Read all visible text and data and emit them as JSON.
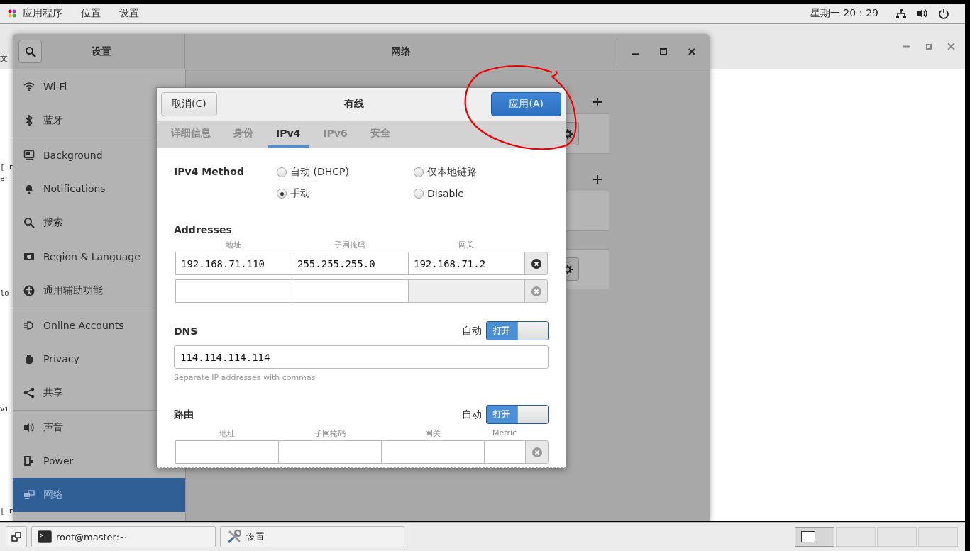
{
  "top_bar": {
    "menus": [
      "应用程序",
      "位置",
      "设置"
    ],
    "clock": "星期一 20：29"
  },
  "background_window": {
    "fragments": [
      "文",
      "[ r",
      "er",
      "lo",
      "vi",
      "[ r"
    ]
  },
  "settings": {
    "sidebar_title": "设置",
    "title": "网络",
    "sidebar": [
      {
        "label": "Wi-Fi",
        "kind": "wifi",
        "selected": false,
        "divider_before": false
      },
      {
        "label": "蓝牙",
        "kind": "bluetooth",
        "selected": false,
        "divider_before": false
      },
      {
        "label": "Background",
        "kind": "background",
        "selected": false,
        "divider_before": true
      },
      {
        "label": "Notifications",
        "kind": "bell",
        "selected": false,
        "divider_before": false
      },
      {
        "label": "搜索",
        "kind": "search",
        "selected": false,
        "divider_before": false
      },
      {
        "label": "Region & Language",
        "kind": "region",
        "selected": false,
        "divider_before": false
      },
      {
        "label": "通用辅助功能",
        "kind": "accessibility",
        "selected": false,
        "divider_before": false
      },
      {
        "label": "Online Accounts",
        "kind": "accounts",
        "selected": false,
        "divider_before": true
      },
      {
        "label": "Privacy",
        "kind": "hand",
        "selected": false,
        "divider_before": false
      },
      {
        "label": "共享",
        "kind": "share",
        "selected": false,
        "divider_before": false
      },
      {
        "label": "声音",
        "kind": "sound",
        "selected": false,
        "divider_before": true
      },
      {
        "label": "Power",
        "kind": "power",
        "selected": false,
        "divider_before": false
      },
      {
        "label": "网络",
        "kind": "network",
        "selected": true,
        "divider_before": false
      }
    ]
  },
  "dialog": {
    "title": "有线",
    "cancel": "取消(C)",
    "apply": "应用(A)",
    "tabs": [
      {
        "label": "详细信息",
        "selected": false
      },
      {
        "label": "身份",
        "selected": false
      },
      {
        "label": "IPv4",
        "selected": true
      },
      {
        "label": "IPv6",
        "selected": false
      },
      {
        "label": "安全",
        "selected": false
      }
    ],
    "method_label": "IPv4 Method",
    "methods": [
      {
        "label": "自动 (DHCP)",
        "selected": false
      },
      {
        "label": "仅本地链路",
        "selected": false
      },
      {
        "label": "手动",
        "selected": true
      },
      {
        "label": "Disable",
        "selected": false
      }
    ],
    "addresses": {
      "title": "Addresses",
      "columns": [
        "地址",
        "子网掩码",
        "网关"
      ],
      "rows": [
        [
          "192.168.71.110",
          "255.255.255.0",
          "192.168.71.2"
        ]
      ]
    },
    "dns": {
      "title": "DNS",
      "auto_label": "自动",
      "switch_label": "打开",
      "on": true,
      "value": "114.114.114.114",
      "hint": "Separate IP addresses with commas"
    },
    "routes": {
      "title": "路由",
      "auto_label": "自动",
      "switch_label": "打开",
      "on": true,
      "columns": [
        "地址",
        "子网掩码",
        "网关",
        "Metric"
      ]
    }
  },
  "taskbar": {
    "tasks": [
      {
        "label": "root@master:~",
        "kind": "terminal"
      },
      {
        "label": "设置",
        "kind": "tools"
      }
    ],
    "workspaces": [
      {
        "selected": true
      },
      {
        "selected": false
      },
      {
        "selected": false
      },
      {
        "selected": false
      }
    ]
  }
}
